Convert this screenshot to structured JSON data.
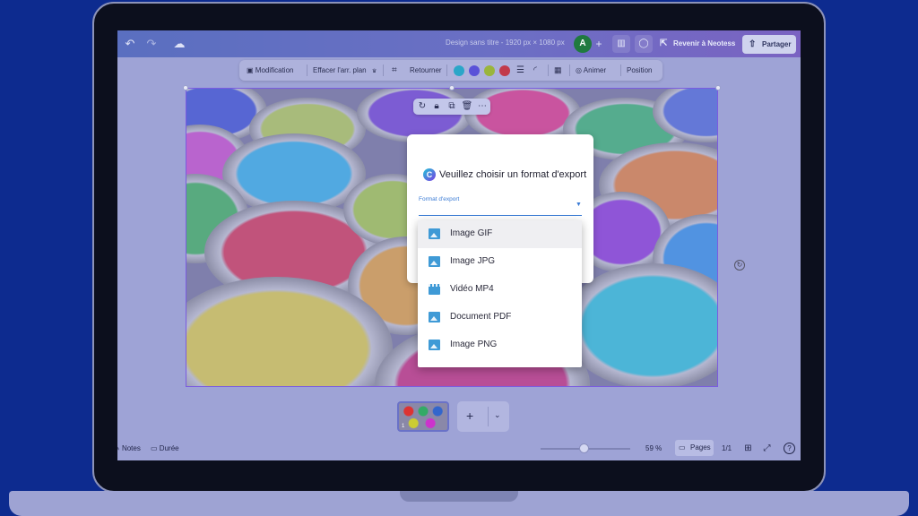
{
  "header": {
    "undo_icon": "undo-icon",
    "redo_icon": "redo-icon",
    "cloud_icon": "cloud-sync-icon",
    "doc_title": "Design sans titre - 1920 px × 1080 px",
    "avatar_initial": "A",
    "add_icon": "+",
    "revenir_label": "Revenir à Neotess",
    "partager_label": "Partager"
  },
  "toolbar": {
    "modification": "Modification",
    "effacer": "Effacer l'arr. plan",
    "retourner": "Retourner",
    "animer": "Animer",
    "position": "Position",
    "colors": [
      "#2aa6c8",
      "#5a52d8",
      "#9ab53c",
      "#c23a4a"
    ]
  },
  "dialog": {
    "title": "Veuillez choisir un format d'export",
    "field_label": "Format d'export",
    "options": [
      {
        "label": "Image GIF",
        "icon": "image-icon",
        "selected": true
      },
      {
        "label": "Image JPG",
        "icon": "image-icon",
        "selected": false
      },
      {
        "label": "Vidéo MP4",
        "icon": "video-icon",
        "selected": false
      },
      {
        "label": "Document PDF",
        "icon": "image-icon",
        "selected": false
      },
      {
        "label": "Image PNG",
        "icon": "image-icon",
        "selected": false
      }
    ]
  },
  "pages": {
    "thumb_number": "1",
    "add_label": "+"
  },
  "footer": {
    "notes": "Notes",
    "duree": "Durée",
    "zoom": "59 %",
    "pages": "Pages",
    "page_count": "1/1",
    "help": "?"
  }
}
